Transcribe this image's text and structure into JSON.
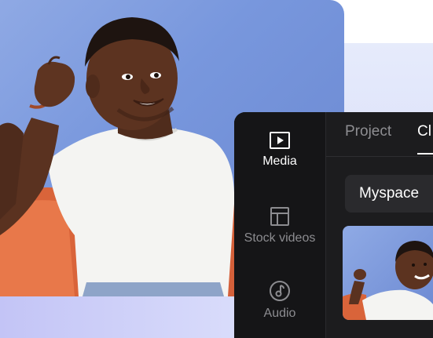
{
  "panel": {
    "sidebar": {
      "items": [
        {
          "label": "Media",
          "icon": "play-icon",
          "active": true
        },
        {
          "label": "Stock videos",
          "icon": "layout-icon",
          "active": false
        },
        {
          "label": "Audio",
          "icon": "music-note-icon",
          "active": false
        }
      ]
    },
    "tabs": [
      {
        "label": "Project"
      },
      {
        "label": "Cl"
      }
    ],
    "myspace_label": "Myspace"
  },
  "colors": {
    "panel_bg": "#1c1c1e",
    "sidebar_bg": "#151517",
    "hero_bg": "#7897dd",
    "accent_text": "#ffffff",
    "muted_text": "#8c8c90"
  }
}
